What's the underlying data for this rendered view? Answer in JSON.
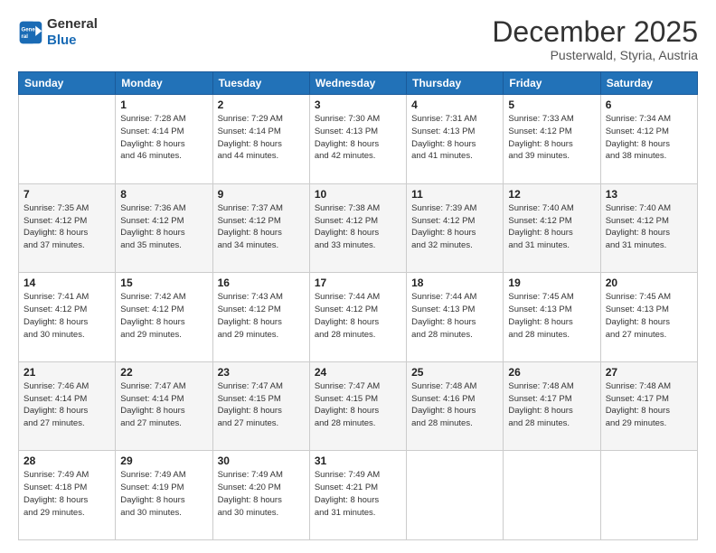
{
  "header": {
    "logo_line1": "General",
    "logo_line2": "Blue",
    "month": "December 2025",
    "location": "Pusterwald, Styria, Austria"
  },
  "weekdays": [
    "Sunday",
    "Monday",
    "Tuesday",
    "Wednesday",
    "Thursday",
    "Friday",
    "Saturday"
  ],
  "weeks": [
    [
      {
        "day": "",
        "info": ""
      },
      {
        "day": "1",
        "info": "Sunrise: 7:28 AM\nSunset: 4:14 PM\nDaylight: 8 hours\nand 46 minutes."
      },
      {
        "day": "2",
        "info": "Sunrise: 7:29 AM\nSunset: 4:14 PM\nDaylight: 8 hours\nand 44 minutes."
      },
      {
        "day": "3",
        "info": "Sunrise: 7:30 AM\nSunset: 4:13 PM\nDaylight: 8 hours\nand 42 minutes."
      },
      {
        "day": "4",
        "info": "Sunrise: 7:31 AM\nSunset: 4:13 PM\nDaylight: 8 hours\nand 41 minutes."
      },
      {
        "day": "5",
        "info": "Sunrise: 7:33 AM\nSunset: 4:12 PM\nDaylight: 8 hours\nand 39 minutes."
      },
      {
        "day": "6",
        "info": "Sunrise: 7:34 AM\nSunset: 4:12 PM\nDaylight: 8 hours\nand 38 minutes."
      }
    ],
    [
      {
        "day": "7",
        "info": "Sunrise: 7:35 AM\nSunset: 4:12 PM\nDaylight: 8 hours\nand 37 minutes."
      },
      {
        "day": "8",
        "info": "Sunrise: 7:36 AM\nSunset: 4:12 PM\nDaylight: 8 hours\nand 35 minutes."
      },
      {
        "day": "9",
        "info": "Sunrise: 7:37 AM\nSunset: 4:12 PM\nDaylight: 8 hours\nand 34 minutes."
      },
      {
        "day": "10",
        "info": "Sunrise: 7:38 AM\nSunset: 4:12 PM\nDaylight: 8 hours\nand 33 minutes."
      },
      {
        "day": "11",
        "info": "Sunrise: 7:39 AM\nSunset: 4:12 PM\nDaylight: 8 hours\nand 32 minutes."
      },
      {
        "day": "12",
        "info": "Sunrise: 7:40 AM\nSunset: 4:12 PM\nDaylight: 8 hours\nand 31 minutes."
      },
      {
        "day": "13",
        "info": "Sunrise: 7:40 AM\nSunset: 4:12 PM\nDaylight: 8 hours\nand 31 minutes."
      }
    ],
    [
      {
        "day": "14",
        "info": "Sunrise: 7:41 AM\nSunset: 4:12 PM\nDaylight: 8 hours\nand 30 minutes."
      },
      {
        "day": "15",
        "info": "Sunrise: 7:42 AM\nSunset: 4:12 PM\nDaylight: 8 hours\nand 29 minutes."
      },
      {
        "day": "16",
        "info": "Sunrise: 7:43 AM\nSunset: 4:12 PM\nDaylight: 8 hours\nand 29 minutes."
      },
      {
        "day": "17",
        "info": "Sunrise: 7:44 AM\nSunset: 4:12 PM\nDaylight: 8 hours\nand 28 minutes."
      },
      {
        "day": "18",
        "info": "Sunrise: 7:44 AM\nSunset: 4:13 PM\nDaylight: 8 hours\nand 28 minutes."
      },
      {
        "day": "19",
        "info": "Sunrise: 7:45 AM\nSunset: 4:13 PM\nDaylight: 8 hours\nand 28 minutes."
      },
      {
        "day": "20",
        "info": "Sunrise: 7:45 AM\nSunset: 4:13 PM\nDaylight: 8 hours\nand 27 minutes."
      }
    ],
    [
      {
        "day": "21",
        "info": "Sunrise: 7:46 AM\nSunset: 4:14 PM\nDaylight: 8 hours\nand 27 minutes."
      },
      {
        "day": "22",
        "info": "Sunrise: 7:47 AM\nSunset: 4:14 PM\nDaylight: 8 hours\nand 27 minutes."
      },
      {
        "day": "23",
        "info": "Sunrise: 7:47 AM\nSunset: 4:15 PM\nDaylight: 8 hours\nand 27 minutes."
      },
      {
        "day": "24",
        "info": "Sunrise: 7:47 AM\nSunset: 4:15 PM\nDaylight: 8 hours\nand 28 minutes."
      },
      {
        "day": "25",
        "info": "Sunrise: 7:48 AM\nSunset: 4:16 PM\nDaylight: 8 hours\nand 28 minutes."
      },
      {
        "day": "26",
        "info": "Sunrise: 7:48 AM\nSunset: 4:17 PM\nDaylight: 8 hours\nand 28 minutes."
      },
      {
        "day": "27",
        "info": "Sunrise: 7:48 AM\nSunset: 4:17 PM\nDaylight: 8 hours\nand 29 minutes."
      }
    ],
    [
      {
        "day": "28",
        "info": "Sunrise: 7:49 AM\nSunset: 4:18 PM\nDaylight: 8 hours\nand 29 minutes."
      },
      {
        "day": "29",
        "info": "Sunrise: 7:49 AM\nSunset: 4:19 PM\nDaylight: 8 hours\nand 30 minutes."
      },
      {
        "day": "30",
        "info": "Sunrise: 7:49 AM\nSunset: 4:20 PM\nDaylight: 8 hours\nand 30 minutes."
      },
      {
        "day": "31",
        "info": "Sunrise: 7:49 AM\nSunset: 4:21 PM\nDaylight: 8 hours\nand 31 minutes."
      },
      {
        "day": "",
        "info": ""
      },
      {
        "day": "",
        "info": ""
      },
      {
        "day": "",
        "info": ""
      }
    ]
  ]
}
